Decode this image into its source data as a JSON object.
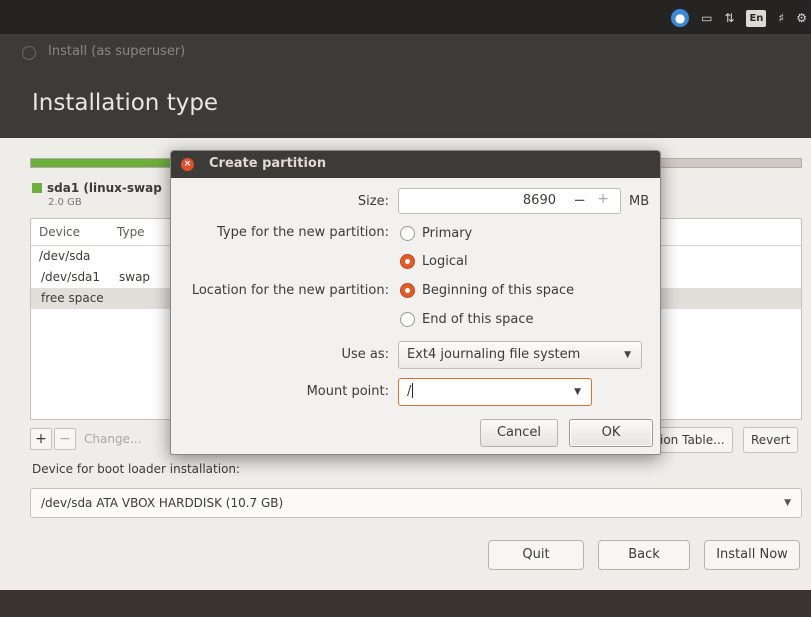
{
  "top_panel": {
    "icons": [
      "accessibility-icon",
      "battery-icon",
      "network-icon",
      "keyboard-layout-icon",
      "volume-icon",
      "power-gear-icon"
    ],
    "keyboard_layout": "En"
  },
  "window": {
    "title": "Install (as superuser)",
    "page_title": "Installation type"
  },
  "partition_map": {
    "used_fraction": 0.19,
    "legend": {
      "name": "sda1 (linux-swap",
      "size": "2.0 GB",
      "color": "#6eae3c"
    }
  },
  "partition_table": {
    "columns": [
      "Device",
      "Type"
    ],
    "rows": [
      {
        "device": "/dev/sda",
        "type": ""
      },
      {
        "device": "/dev/sda1",
        "type": "swap"
      },
      {
        "device": "free space",
        "type": ""
      }
    ]
  },
  "table_buttons": {
    "add": "+",
    "remove": "−",
    "change": "Change...",
    "new_table": "ion Table...",
    "revert": "Revert"
  },
  "boot_loader": {
    "label": "Device for boot loader installation:",
    "value": "/dev/sda ATA VBOX HARDDISK (10.7 GB)"
  },
  "nav": {
    "quit": "Quit",
    "back": "Back",
    "install_now": "Install Now"
  },
  "dialog": {
    "title": "Create partition",
    "size_label": "Size:",
    "size_value": "8690",
    "size_minus": "−",
    "size_plus": "+",
    "size_unit": "MB",
    "type_label": "Type for the new partition:",
    "type_options": [
      "Primary",
      "Logical"
    ],
    "type_selected": "Logical",
    "location_label": "Location for the new partition:",
    "location_options": [
      "Beginning of this space",
      "End of this space"
    ],
    "location_selected": "Beginning of this space",
    "use_as_label": "Use as:",
    "use_as_value": "Ext4 journaling file system",
    "mount_label": "Mount point:",
    "mount_value": "/",
    "cancel": "Cancel",
    "ok": "OK"
  },
  "colors": {
    "accent_orange": "#e05c2c",
    "partition_green": "#6eae3c",
    "header_dark": "#3c3b37"
  }
}
